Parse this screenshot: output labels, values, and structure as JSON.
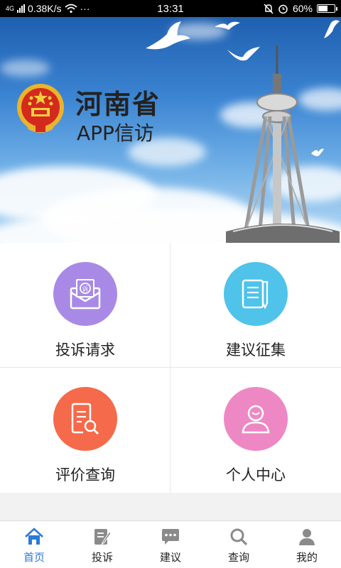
{
  "status_bar": {
    "network": "4G",
    "speed": "0.38K/s",
    "more": "···",
    "time": "13:31",
    "battery": "60%",
    "battery_level": 0.6
  },
  "hero": {
    "title": "河南省",
    "subtitle": "APP信访"
  },
  "grid": {
    "items": [
      {
        "label": "投诉请求",
        "icon": "complaint-envelope-icon",
        "color": "#a88ae6"
      },
      {
        "label": "建议征集",
        "icon": "suggestion-document-icon",
        "color": "#4fc3ea"
      },
      {
        "label": "评价查询",
        "icon": "evaluation-search-icon",
        "color": "#f56a4a"
      },
      {
        "label": "个人中心",
        "icon": "user-profile-icon",
        "color": "#ee88c4"
      }
    ]
  },
  "tabbar": {
    "tabs": [
      {
        "label": "首页",
        "icon": "home-icon",
        "active": true
      },
      {
        "label": "投诉",
        "icon": "complaint-edit-icon",
        "active": false
      },
      {
        "label": "建议",
        "icon": "chat-bubble-icon",
        "active": false
      },
      {
        "label": "查询",
        "icon": "search-icon",
        "active": false
      },
      {
        "label": "我的",
        "icon": "person-icon",
        "active": false
      }
    ]
  },
  "colors": {
    "accent": "#2a7ad8",
    "inactive_icon": "#8a8a8a"
  }
}
